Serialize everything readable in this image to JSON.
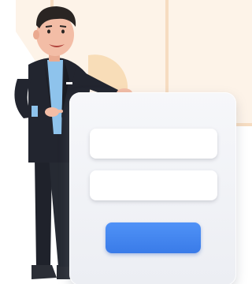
{
  "illustration": {
    "subject": "businessman-with-login-form",
    "colors": {
      "backdrop": "#fdf1e5",
      "backdrop_lines": "#f6dcc1",
      "accent_circle": "#f8ddb8",
      "suit": "#22252f",
      "shirt": "#8ec3ec",
      "skin": "#f3bda6",
      "hair": "#2a2523",
      "card": "#eef0f4",
      "field": "#ffffff",
      "button": "#3f85ef"
    }
  }
}
